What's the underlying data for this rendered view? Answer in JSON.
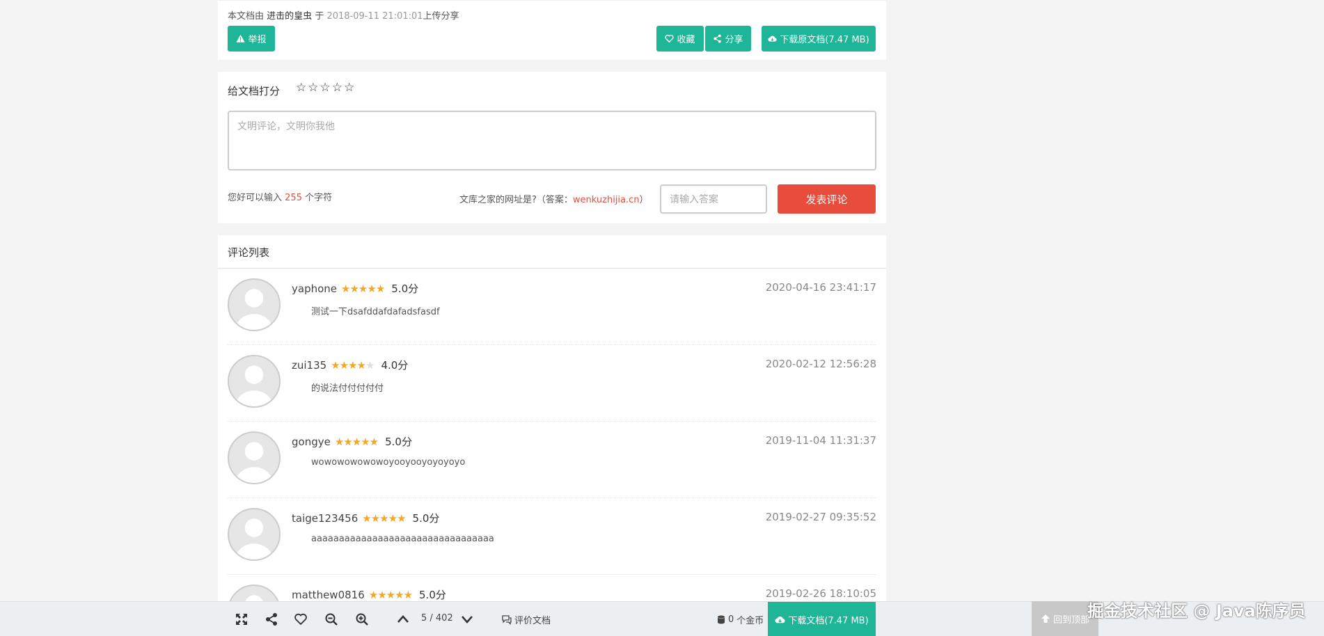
{
  "doc_info": {
    "prefix": "本文档由",
    "uploader": "进击的皇虫",
    "mid": "于",
    "date": "2018-09-11 21:01:01",
    "suffix": "上传分享"
  },
  "actions": {
    "report": "举报",
    "favorite": "收藏",
    "share": "分享",
    "download": "下载原文档(7.47 MB)"
  },
  "rating": {
    "label": "给文档打分",
    "star_glyph": "☆"
  },
  "comment_form": {
    "placeholder": "文明评论，文明你我他",
    "chars_prefix": "您好可以输入",
    "chars_count": "255",
    "chars_suffix": "个字符",
    "question_prefix": "文库之家的网址是?（答案：",
    "question_answer": "wenkuzhijia.cn",
    "question_suffix": "）",
    "answer_placeholder": "请输入答案",
    "submit": "发表评论"
  },
  "comments": {
    "title": "评论列表",
    "items": [
      {
        "user": "yaphone",
        "rating": 5,
        "score": "5.0分",
        "time": "2020-04-16 23:41:17",
        "text": "测试一下dsafddafdafadsfasdf"
      },
      {
        "user": "zui135",
        "rating": 4,
        "score": "4.0分",
        "time": "2020-02-12 12:56:28",
        "text": "的说法付付付付付"
      },
      {
        "user": "gongye",
        "rating": 5,
        "score": "5.0分",
        "time": "2019-11-04 11:31:37",
        "text": "wowowowowowoyooyooyoyoyoyo"
      },
      {
        "user": "taige123456",
        "rating": 5,
        "score": "5.0分",
        "time": "2019-02-27 09:35:52",
        "text": "aaaaaaaaaaaaaaaaaaaaaaaaaaaaaaaaa"
      },
      {
        "user": "matthew0816",
        "rating": 5,
        "score": "5.0分",
        "time": "2019-02-26 18:10:05",
        "text": ""
      }
    ]
  },
  "toolbar": {
    "pages": "5 / 402",
    "evaluate": "评价文档",
    "coins_count": "0",
    "coins_label": "个金币",
    "download": "下载文档(7.47 MB)"
  },
  "back_to_top": "回到顶部",
  "watermark": "掘金技术社区 @ Java陈序员",
  "colors": {
    "accent": "#1fb597",
    "danger": "#e74c3c",
    "star": "#f5a623"
  }
}
